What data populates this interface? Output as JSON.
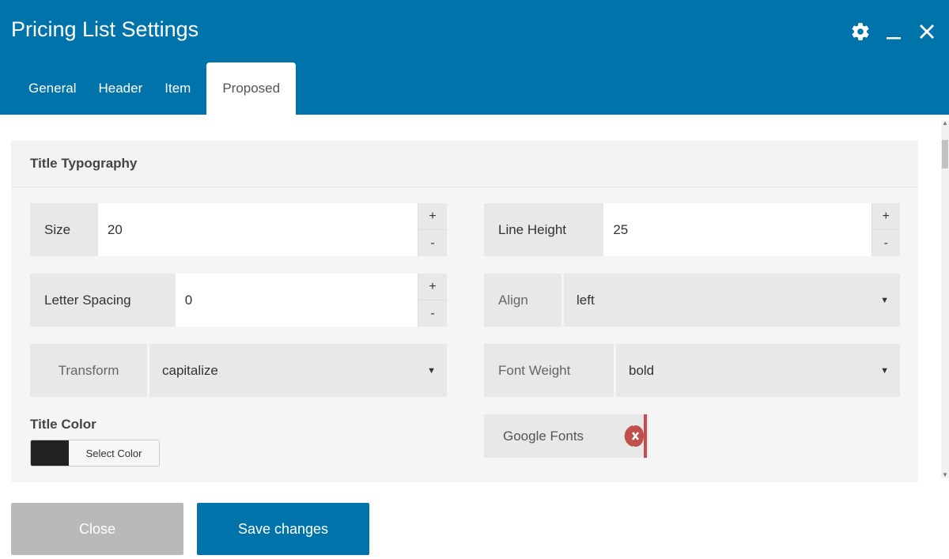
{
  "window": {
    "title": "Pricing List Settings",
    "icons": [
      "gear-icon",
      "minimize-icon",
      "close-icon"
    ]
  },
  "tabs": [
    {
      "label": "General",
      "active": false
    },
    {
      "label": "Header",
      "active": false
    },
    {
      "label": "Item",
      "active": false
    },
    {
      "label": "Proposed",
      "active": true
    }
  ],
  "panel": {
    "heading": "Title Typography",
    "size": {
      "label": "Size",
      "value": "20",
      "plus": "+",
      "minus": "-"
    },
    "line_height": {
      "label": "Line Height",
      "value": "25",
      "plus": "+",
      "minus": "-"
    },
    "letter_spacing": {
      "label": "Letter Spacing",
      "value": "0",
      "plus": "+",
      "minus": "-"
    },
    "align": {
      "label": "Align",
      "value": "left"
    },
    "transform": {
      "label": "Transform",
      "value": "capitalize"
    },
    "font_weight": {
      "label": "Font Weight",
      "value": "bold"
    },
    "title_color": {
      "label": "Title Color",
      "button": "Select Color",
      "swatch": "#222222"
    },
    "google_fonts": {
      "label": "Google Fonts"
    }
  },
  "footer": {
    "close_label": "Close",
    "save_label": "Save changes"
  },
  "colors": {
    "accent": "#0073aa",
    "toggle_off": "#c0504d",
    "close_button": "#b9b9b9"
  }
}
